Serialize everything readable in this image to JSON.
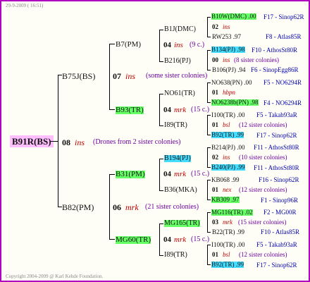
{
  "header": "29-9-2009 ( 16:51)",
  "footer": "Copyright 2004-2009 @ Karl Kehde Foundation.",
  "root": {
    "id": "B91R(BS)",
    "num": "08",
    "ins": "ins",
    "note": "(Drones from 2 sister colonies)"
  },
  "gen1": [
    {
      "id": "B75J(BS)",
      "num": "07",
      "ins": "ins",
      "note": "(some sister colonies)"
    },
    {
      "id": "B82(PM)",
      "num": "06",
      "ins": "mrk",
      "note": "(21 sister colonies)"
    }
  ],
  "gen2": [
    {
      "id": "B7(PM)",
      "num": "04",
      "ins": "ins",
      "note": "(9 c.)"
    },
    {
      "id": "B93(TR)",
      "num": "04",
      "ins": "mrk",
      "note": "(15 c.)"
    },
    {
      "id": "B31(PM)",
      "num": "04",
      "ins": "mrk",
      "note": "(15 c.)"
    },
    {
      "id": "MG60(TR)",
      "num": "04",
      "ins": "mrk",
      "note": "(15 c.)"
    }
  ],
  "gen3": [
    {
      "id": "B1J(DMC)"
    },
    {
      "id": "B216(PJ)"
    },
    {
      "id": "NO61(TR)"
    },
    {
      "id": "I89(TR)"
    },
    {
      "id": "B194(PJ)"
    },
    {
      "id": "B36(MKA)"
    },
    {
      "id": "MG165(TR)"
    },
    {
      "id": "I89(TR)"
    }
  ],
  "gen4_blocks": [
    {
      "l1": "B10W(DMC) .00",
      "l1r": "F17 - Sinop62R",
      "num": "02",
      "ins": "ins",
      "note": "",
      "l3": "RW253 .97",
      "l3r": "F8 - Atlas85R"
    },
    {
      "l1": "B134(PJ) .98",
      "l1r": "F10 - AthosSt80R",
      "num": "00",
      "ins": "ins",
      "note": "(8 sister colonies)",
      "l3": "B106(PJ) .94",
      "l3r": "F6 - SinopEgg86R"
    },
    {
      "l1": "NO638(PN) .00",
      "l1r": "F5 - NO6294R",
      "num": "01",
      "ins": "hbpn",
      "note": "",
      "l3": "NO6238b(PN) .98",
      "l3r": "F4 - NO6294R"
    },
    {
      "l1": "I100(TR) .00",
      "l1r": "F5 - Takab93aR",
      "num": "01",
      "ins": "bsl",
      "note": "(12 sister colonies)",
      "l3": "B92(TR) .99",
      "l3r": "F17 - Sinop62R"
    },
    {
      "l1": "B214(PJ) .00",
      "l1r": "F11 - AthosSt80R",
      "num": "02",
      "ins": "ins",
      "note": "(10 sister colonies)",
      "l3": "B240(PJ) .99",
      "l3r": "F11 - AthosSt80R"
    },
    {
      "l1": "KB068 .99",
      "l1r": "F16 - Sinop62R",
      "num": "01",
      "ins": "nex",
      "note": "(12 sister colonies)",
      "l3": "KB309 .97",
      "l3r": "F1 - Sinop96R"
    },
    {
      "l1": "MG116(TR) .02",
      "l1r": "F2 - MG00R",
      "num": "03",
      "ins": "mrk",
      "note": "(15 sister colonies)",
      "l3": "B22(TR) .99",
      "l3r": "F10 - Atlas85R"
    },
    {
      "l1": "I100(TR) .00",
      "l1r": "F5 - Takab93aR",
      "num": "01",
      "ins": "bsl",
      "note": "(12 sister colonies)",
      "l3": "B92(TR) .99",
      "l3r": "F17 - Sinop62R"
    }
  ]
}
